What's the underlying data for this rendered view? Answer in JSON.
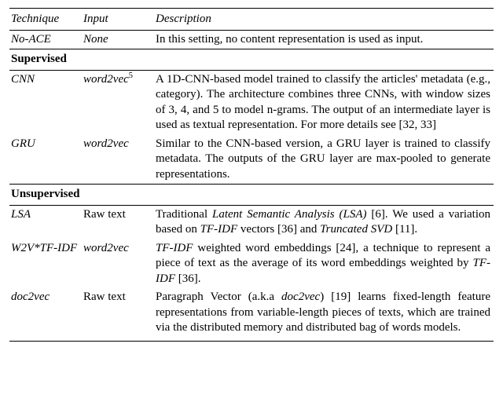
{
  "chart_data": {
    "type": "table",
    "columns": [
      "Technique",
      "Input",
      "Description"
    ],
    "rows": [
      {
        "technique": "No-ACE",
        "input": "None",
        "description": "In this setting, no content representation is used as input.",
        "section": null
      },
      {
        "section_header": "Supervised"
      },
      {
        "technique": "CNN",
        "input": "word2vec",
        "input_sup": "5",
        "description": "A 1D-CNN-based model trained to classify the articles' metadata (e.g., category). The architecture combines three CNNs, with window sizes of 3, 4, and 5 to model n-grams. The output of an intermediate layer is used as textual representation. For more details see [32, 33]"
      },
      {
        "technique": "GRU",
        "input": "word2vec",
        "description": "Similar to the CNN-based version, a GRU layer is trained to classify metadata. The outputs of the GRU layer are max-pooled to generate representations."
      },
      {
        "section_header": "Unsupervised"
      },
      {
        "technique": "LSA",
        "input": "Raw text",
        "description_html": "Traditional <i>Latent Semantic Analysis (LSA)</i> [6]. We used a variation based on <i>TF-IDF</i> vectors [36] and <i>Truncated SVD</i> [11]."
      },
      {
        "technique": "W2V*TF-IDF",
        "input": "word2vec",
        "description_html": "<i>TF-IDF</i> weighted word embeddings [24], a technique to represent a piece of text as the average of its word embeddings weighted by <i>TF-IDF</i> [36]."
      },
      {
        "technique": "doc2vec",
        "input": "Raw text",
        "description_html": "Paragraph Vector (a.k.a <i>doc2vec</i>) [19] learns fixed-length feature representations from variable-length pieces of texts, which are trained via the distributed memory and distributed bag of words models."
      }
    ]
  },
  "header": {
    "technique": "Technique",
    "input": "Input",
    "description": "Description"
  },
  "rows": {
    "noace": {
      "technique": "No-ACE",
      "input": "None",
      "desc": "In this setting, no content representation is used as input."
    },
    "sec1": "Supervised",
    "cnn": {
      "technique": "CNN",
      "input": "word2vec",
      "sup": "5",
      "desc": "A 1D-CNN-based model trained to classify the articles' metadata (e.g., category). The architecture combines three CNNs, with window sizes of 3, 4, and 5 to model n-grams. The output of an intermediate layer is used as textual representation. For more details see [32, 33]"
    },
    "gru": {
      "technique": "GRU",
      "input": "word2vec",
      "desc": "Similar to the CNN-based version, a GRU layer is trained to classify metadata. The outputs of the GRU layer are max-pooled to generate representations."
    },
    "sec2": "Unsupervised",
    "lsa": {
      "technique": "LSA",
      "input": "Raw text",
      "desc_pre": "Traditional ",
      "it1": "Latent Semantic Analysis (LSA)",
      "mid1": " [6]. We used a variation based on ",
      "it2": "TF-IDF",
      "mid2": " vectors [36] and ",
      "it3": "Truncated SVD",
      "tail": " [11]."
    },
    "w2v": {
      "technique": "W2V*TF-IDF",
      "input": "word2vec",
      "it1": "TF-IDF",
      "mid1": " weighted word embeddings [24], a technique to represent a piece of text as the average of its word embeddings weighted by ",
      "it2": "TF-IDF",
      "tail": " [36]."
    },
    "d2v": {
      "technique": "doc2vec",
      "input": "Raw text",
      "pre": "Paragraph Vector (a.k.a ",
      "it1": "doc2vec",
      "tail": ") [19] learns fixed-length feature representations from variable-length pieces of texts, which are trained via the distributed memory and distributed bag of words models."
    }
  }
}
